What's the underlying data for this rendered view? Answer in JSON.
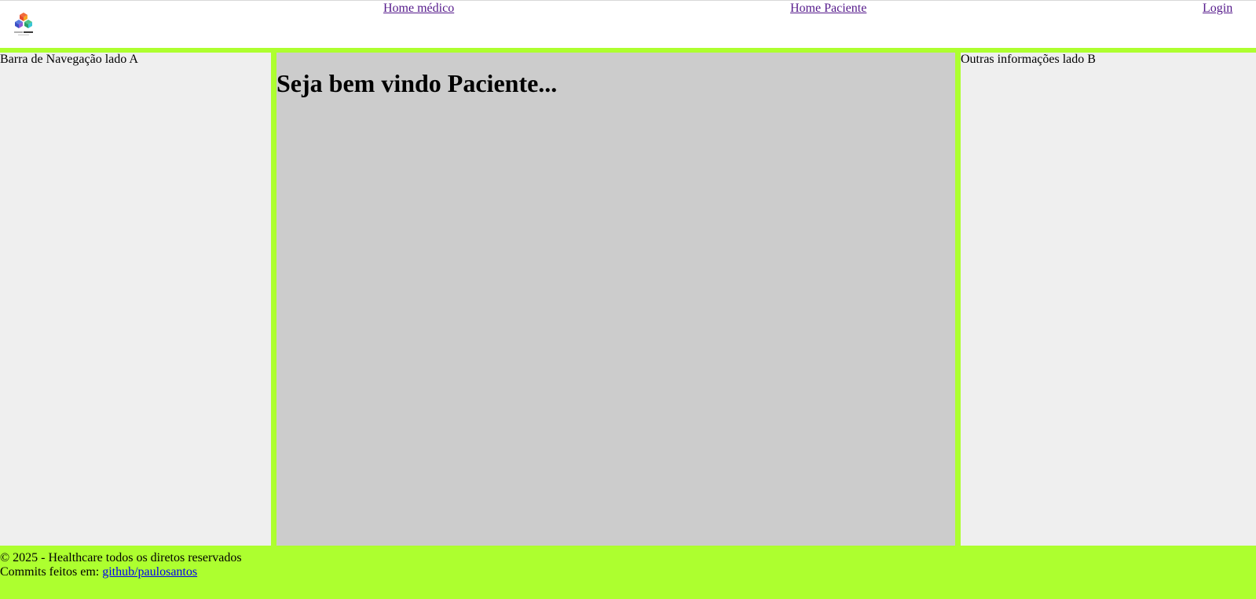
{
  "header": {
    "logo_icon": "company-cube-logo-icon",
    "nav": {
      "home_medico": "Home médico",
      "home_paciente": "Home Paciente",
      "login": "Login"
    }
  },
  "sidebar_a": {
    "label": "Barra de Navegação lado A"
  },
  "main": {
    "heading": "Seja bem vindo Paciente..."
  },
  "sidebar_b": {
    "label": "Outras informações lado B"
  },
  "footer": {
    "copyright": "© 2025 - Healthcare todos os diretos reservados",
    "commits_prefix": "Commits feitos em: ",
    "commits_link": "github/paulosantos"
  },
  "colors": {
    "accent": "#adff2f",
    "side_panel": "#efefef",
    "main_panel": "#cccccc",
    "visited_link": "#551a8b",
    "link": "#0000ee"
  }
}
